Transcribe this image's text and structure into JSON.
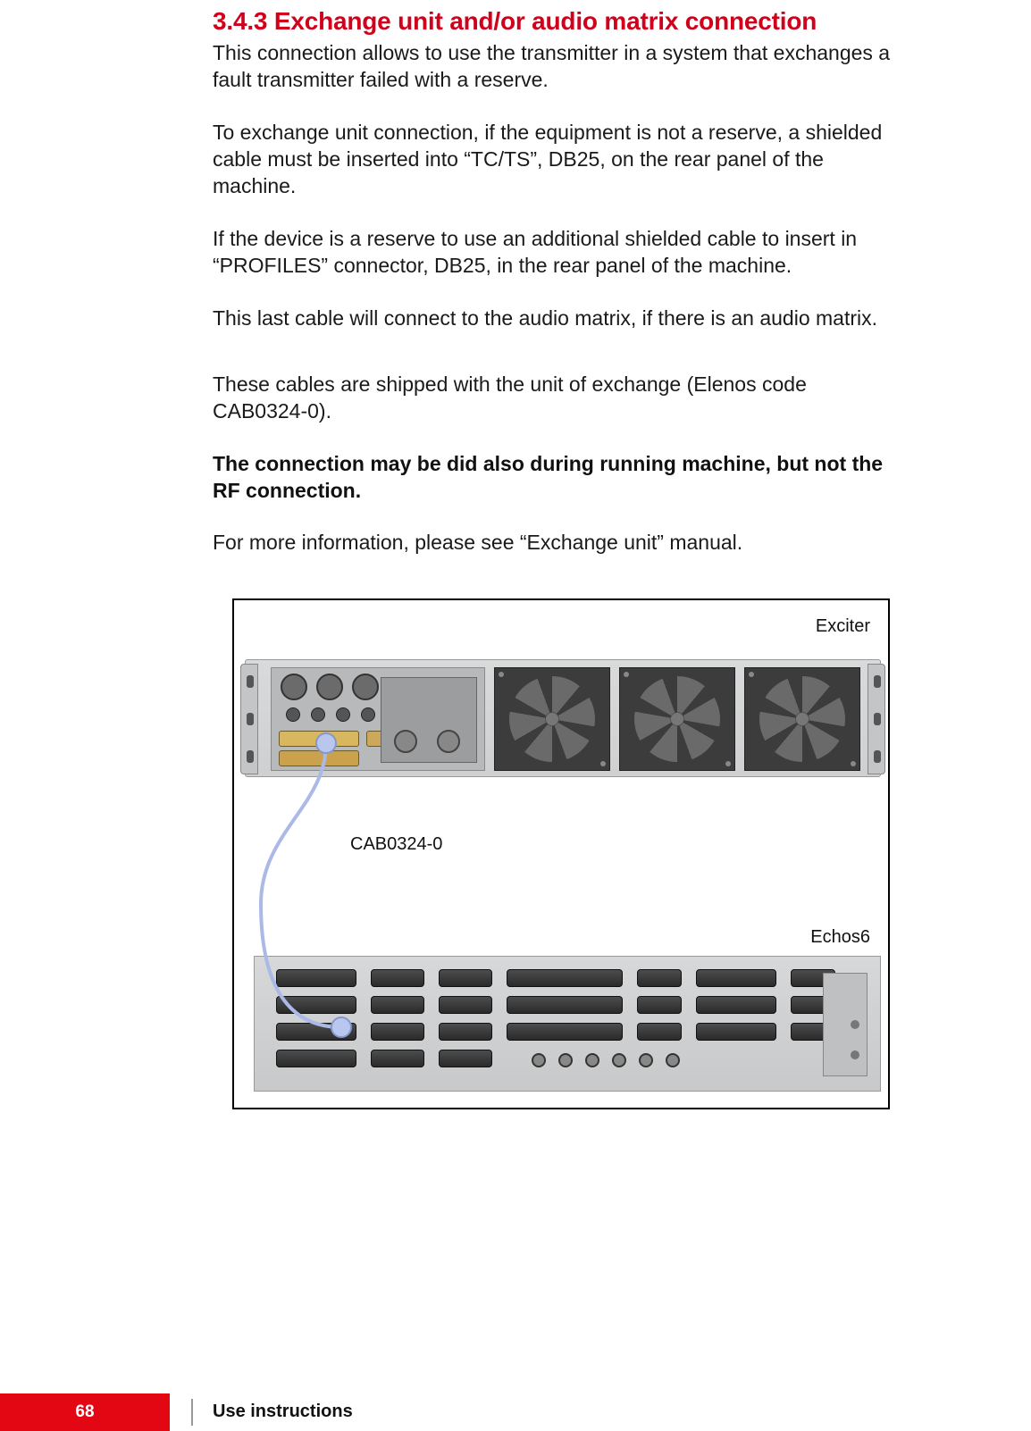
{
  "section": {
    "heading": "3.4.3 Exchange unit and/or audio matrix connection",
    "p1": "This connection allows to use the transmitter in a system that exchanges a fault transmitter failed with a reserve.",
    "p2": "To exchange unit connection, if the equipment is not a reserve, a shielded cable must be inserted into “TC/TS”, DB25, on the rear panel of the machine.",
    "p3": "If the device is a reserve to use an additional shielded cable to insert in “PROFILES” connector, DB25, in the rear panel of the machine.",
    "p4": "This last cable will connect to the audio matrix, if there is an audio matrix.",
    "p5": "These cables are shipped with the unit of exchange (Elenos code CAB0324-0).",
    "p6_bold": "The connection may be did also during running machine, but not the RF connection.",
    "p7": "For more information, please see “Exchange unit” manual."
  },
  "figure": {
    "label_top": "Exciter",
    "label_cable": "CAB0324-0",
    "label_bottom": "Echos6"
  },
  "footer": {
    "page_number": "68",
    "chapter": "Use instructions"
  }
}
